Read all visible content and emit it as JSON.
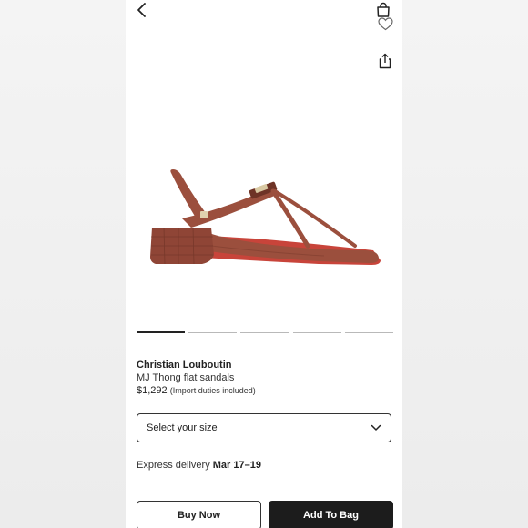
{
  "header": {
    "back_icon": "chevron-left-icon",
    "bag_icon": "shopping-bag-icon",
    "wishlist_icon": "heart-icon",
    "share_icon": "share-icon"
  },
  "carousel": {
    "total_slides": 5,
    "active_index": 0
  },
  "product": {
    "brand": "Christian Louboutin",
    "name": "MJ Thong flat sandals",
    "price": "$1,292",
    "price_note": "(Import duties included)"
  },
  "size_select": {
    "label": "Select your size"
  },
  "delivery": {
    "label": "Express delivery",
    "dates": "Mar 17–19"
  },
  "actions": {
    "buy_now": "Buy Now",
    "add_to_bag": "Add To Bag"
  },
  "colors": {
    "leather": "#9b4f3d",
    "leather_dark": "#7a3a2b",
    "accent_dark": "#1c1c1c"
  }
}
